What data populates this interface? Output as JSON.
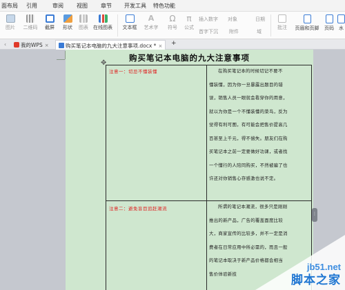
{
  "menu": {
    "items": [
      "面布局",
      "引用",
      "审阅",
      "视图",
      "章节",
      "开发工具",
      "特色功能"
    ]
  },
  "ribbon": {
    "picture": "图片",
    "qrcode": "二维码",
    "screenshot": "截屏",
    "shape": "形状",
    "chart": "图表",
    "online_chart": "在线图表",
    "textbox": "文本框",
    "wordart": "艺术字",
    "symbol": "符号",
    "formula": "公式",
    "insert_number": "插入数字",
    "object": "对象",
    "date": "日期",
    "first_drop_cap": "首字下沉",
    "attachment": "附件",
    "field": "域",
    "comment": "批注",
    "header_footer": "页眉和页脚",
    "page_number": "页码",
    "watermark": "水"
  },
  "tabs": {
    "wps": "我的WPS",
    "doc": "购买笔记本电脑的九大注意事项.docx *",
    "new": "+"
  },
  "document": {
    "title": "购买笔记本电脑的九大注意事项",
    "rows": [
      {
        "left": "注意一：切忌不懂装懂",
        "right": [
          "在购买笔记本的时候切记不要不",
          "懂装懂，因为你一旦暴露出题目的错",
          "误，销售人员一眼就会看穿你的用意，",
          "就以为你是一个不懂装懂的菜鸟，反为",
          "觉得有利可图，有可能会把售价提高几",
          "百甚至上千元，得不偿失。朋友们在购",
          "买笔记本之前一定要做好功课，或者找",
          "一个懂行的人陪同购买，不然被骗了也",
          "许还对你销售心存感激也说不定。"
        ]
      },
      {
        "left": "注意二：避免盲目追赶潮流",
        "right": [
          "所谓的笔记本潮流，很多只是刚刚",
          "推出的新产品，广告的覆盖面度比较",
          "大，商家宣传的比较多，并不一定是消",
          "费者在日常应用中所必需的，而且一般",
          "的笔记本取决于新产品价格都会相当",
          "售价体验新技"
        ]
      }
    ]
  },
  "watermark": {
    "url": "jb51.net",
    "name": "脚本之家"
  },
  "colors": {
    "page_bg": "#cfe7cf",
    "canvas_bg": "#c5c8cf",
    "red_text": "#e02020",
    "watermark_blue": "#1f76d2"
  }
}
